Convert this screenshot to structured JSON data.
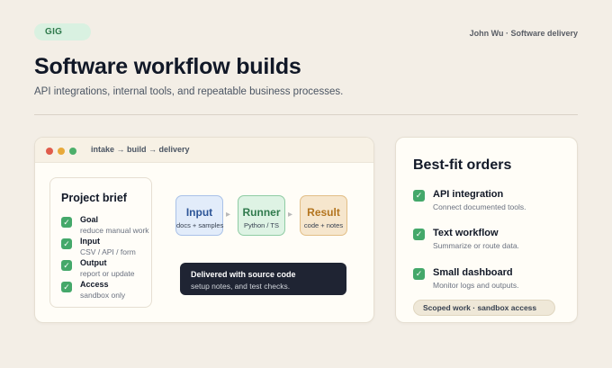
{
  "header": {
    "badge": "GIG",
    "author": "John Wu · Software delivery",
    "title": "Software workflow builds",
    "subtitle": "API integrations, internal tools, and repeatable business processes."
  },
  "window": {
    "path": "intake → build → delivery",
    "brief": {
      "title": "Project brief",
      "items": [
        {
          "label": "Goal",
          "value": "reduce manual work"
        },
        {
          "label": "Input",
          "value": "CSV / API / form"
        },
        {
          "label": "Output",
          "value": "report or update"
        },
        {
          "label": "Access",
          "value": "sandbox only"
        }
      ]
    },
    "flow": [
      {
        "title": "Input",
        "sub": "docs + samples"
      },
      {
        "title": "Runner",
        "sub": "Python / TS"
      },
      {
        "title": "Result",
        "sub": "code + notes"
      }
    ],
    "delivered": {
      "title": "Delivered with source code",
      "sub": "setup notes, and test checks."
    }
  },
  "orders": {
    "title": "Best-fit orders",
    "items": [
      {
        "label": "API integration",
        "desc": "Connect documented tools."
      },
      {
        "label": "Text workflow",
        "desc": "Summarize or route data."
      },
      {
        "label": "Small dashboard",
        "desc": "Monitor logs and outputs."
      }
    ],
    "scope": "Scoped work · sandbox access"
  },
  "icons": {
    "check": "check-icon",
    "arrow": "arrow-right-icon"
  },
  "colors": {
    "background": "#f3eee6",
    "accent_green": "#44a86a",
    "dark_panel": "#1f2433"
  }
}
